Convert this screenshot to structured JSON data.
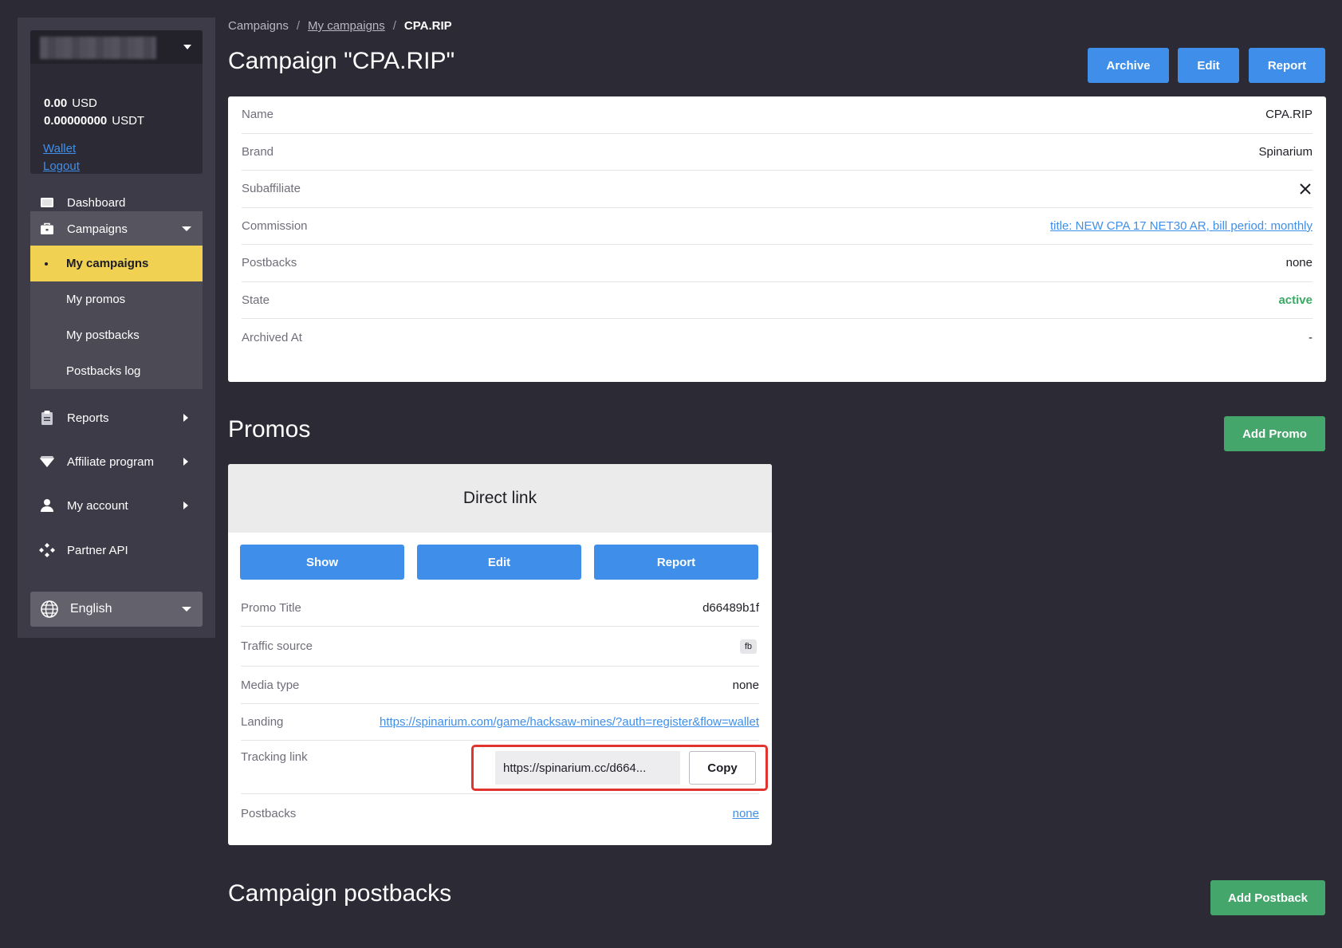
{
  "sidebar": {
    "balance": [
      {
        "amount": "0.00",
        "currency": "USD"
      },
      {
        "amount": "0.00000000",
        "currency": "USDT"
      }
    ],
    "wallet_link": "Wallet",
    "logout_link": "Logout",
    "nav": {
      "dashboard": "Dashboard",
      "campaigns": "Campaigns",
      "reports": "Reports",
      "affiliate_program": "Affiliate program",
      "my_account": "My account",
      "partner_api": "Partner API"
    },
    "campaigns_sub": [
      "My campaigns",
      "My promos",
      "My postbacks",
      "Postbacks log"
    ],
    "language": "English"
  },
  "breadcrumb": {
    "root": "Campaigns",
    "sep1": "/",
    "parent": "My campaigns",
    "sep2": "/",
    "current": "CPA.RIP"
  },
  "page": {
    "title": "Campaign \"CPA.RIP\"",
    "archive_label": "Archive",
    "edit_label": "Edit",
    "report_label": "Report"
  },
  "campaign_details": [
    {
      "label": "Name",
      "value": "CPA.RIP"
    },
    {
      "label": "Brand",
      "value": "Spinarium"
    },
    {
      "label": "Subaffiliate",
      "value": ""
    },
    {
      "label": "Commission",
      "value": "title: NEW CPA 17 NET30 AR, bill period: monthly"
    },
    {
      "label": "Postbacks",
      "value": "none"
    },
    {
      "label": "State",
      "value": "active"
    },
    {
      "label": "Archived At",
      "value": "-"
    }
  ],
  "promos": {
    "title": "Promos",
    "add_label": "Add Promo",
    "card": {
      "header": "Direct link",
      "show_label": "Show",
      "edit_label": "Edit",
      "report_label": "Report",
      "rows": [
        {
          "label": "Promo Title",
          "value": "d66489b1f"
        },
        {
          "label": "Traffic source",
          "value": "fb"
        },
        {
          "label": "Media type",
          "value": "none"
        },
        {
          "label": "Landing",
          "value": "https://spinarium.com/game/hacksaw-mines/?auth=register&flow=wallet"
        },
        {
          "label": "Tracking link",
          "value": "https://spinarium.cc/d664..."
        },
        {
          "label": "Postbacks",
          "value": "none"
        }
      ],
      "copy_label": "Copy"
    }
  },
  "campaign_postbacks": {
    "title": "Campaign postbacks",
    "add_label": "Add Postback"
  },
  "colors": {
    "background": "#2b2a35",
    "sidebar": "#3c3b47",
    "accent_blue": "#3f8fea",
    "accent_green": "#44a66b",
    "active_yellow": "#f0d152",
    "highlight_red": "#e2342f"
  }
}
